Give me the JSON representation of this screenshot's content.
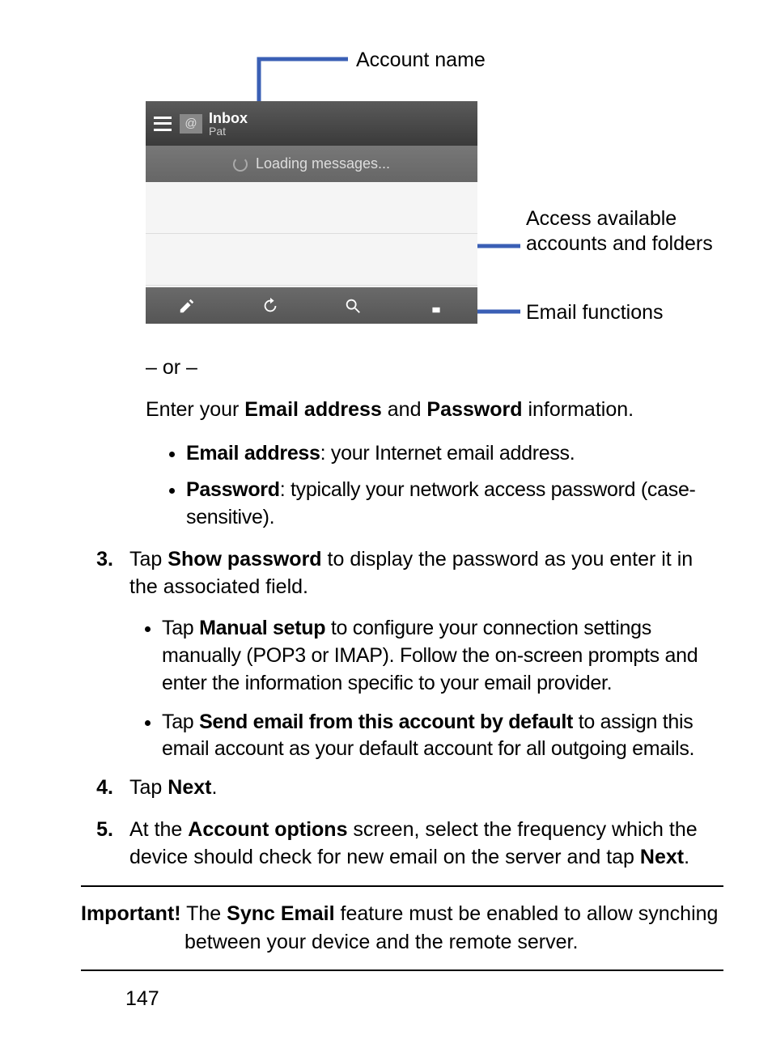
{
  "figure": {
    "callouts": {
      "account_name": "Account name",
      "access_accounts": "Access available accounts and folders",
      "email_functions": "Email functions"
    },
    "ui": {
      "inbox_label": "Inbox",
      "account_sub": "Pat",
      "loading": "Loading messages..."
    }
  },
  "or_text": "– or –",
  "enter_line": {
    "pre": "Enter your ",
    "b1": "Email address",
    "mid": " and ",
    "b2": "Password",
    "post": " information."
  },
  "sub1": {
    "i1_b": "Email address",
    "i1_r": ": your Internet email address.",
    "i2_b": "Password",
    "i2_r": ": typically your network access password (case-sensitive)."
  },
  "step3": {
    "num": "3.",
    "pre": "Tap ",
    "b": "Show password",
    "post": " to display the password as you enter it in the associated field.",
    "sub1_pre": "Tap ",
    "sub1_b": "Manual setup",
    "sub1_post": " to configure your connection settings manually (POP3 or IMAP). Follow the on-screen prompts and enter the information specific to your email provider.",
    "sub2_pre": "Tap ",
    "sub2_b": "Send email from this account by default",
    "sub2_post": " to assign this email account as your default account for all outgoing emails."
  },
  "step4": {
    "num": "4.",
    "pre": "Tap ",
    "b": "Next",
    "post": "."
  },
  "step5": {
    "num": "5.",
    "pre": "At the ",
    "b1": "Account options",
    "mid": " screen, select the frequency which the device should check for new email on the server and tap ",
    "b2": "Next",
    "post": "."
  },
  "important": {
    "label": "Important!",
    "pre": " The ",
    "b": "Sync Email",
    "post1": " feature must be enabled to allow synching",
    "post2": "between your device and the remote server."
  },
  "page_number": "147"
}
